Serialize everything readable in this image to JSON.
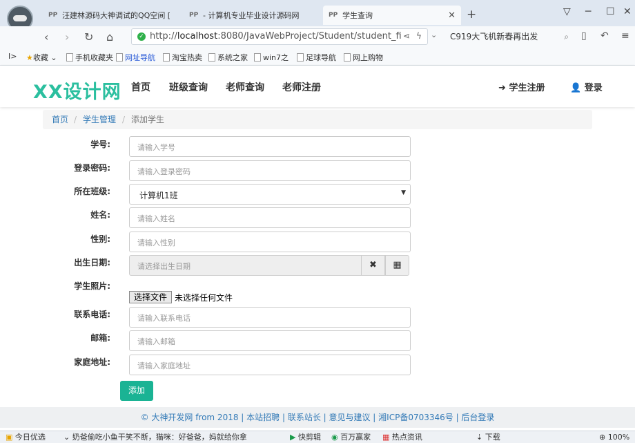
{
  "browser": {
    "tabs": [
      {
        "favicon": "PP",
        "title": "汪建林源码大神调试的QQ空间 [",
        "active": false
      },
      {
        "favicon": "PP",
        "title": "- 计算机专业毕业设计源码网",
        "active": false
      },
      {
        "favicon": "PP",
        "title": "学生查询",
        "active": true
      }
    ],
    "url": {
      "prefix": "http://",
      "host": "localhost",
      "rest": ":8080/JavaWebProject/Student/student_fi"
    },
    "search_text": "C919大飞机新春再出发",
    "bookmarks": [
      {
        "label": "收藏",
        "kind": "star"
      },
      {
        "label": "手机收藏夹",
        "kind": "page"
      },
      {
        "label": "网址导航",
        "kind": "blue"
      },
      {
        "label": "淘宝热卖",
        "kind": "page"
      },
      {
        "label": "系统之家",
        "kind": "page"
      },
      {
        "label": "win7之",
        "kind": "page"
      },
      {
        "label": "足球导航",
        "kind": "page"
      },
      {
        "label": "网上购物",
        "kind": "page"
      }
    ]
  },
  "site": {
    "logo": "XX设计网",
    "nav": [
      "首页",
      "班级查询",
      "老师查询",
      "老师注册"
    ],
    "register_label": "学生注册",
    "login_label": "登录"
  },
  "breadcrumb": {
    "home": "首页",
    "section": "学生管理",
    "current": "添加学生"
  },
  "form": {
    "student_no": {
      "label": "学号:",
      "placeholder": "请输入学号"
    },
    "password": {
      "label": "登录密码:",
      "placeholder": "请输入登录密码"
    },
    "class": {
      "label": "所在班级:",
      "value": "计算机1班"
    },
    "name": {
      "label": "姓名:",
      "placeholder": "请输入姓名"
    },
    "gender": {
      "label": "性别:",
      "placeholder": "请输入性别"
    },
    "birthday": {
      "label": "出生日期:",
      "placeholder": "请选择出生日期"
    },
    "photo": {
      "label": "学生照片:",
      "button": "选择文件",
      "status": "未选择任何文件"
    },
    "phone": {
      "label": "联系电话:",
      "placeholder": "请输入联系电话"
    },
    "email": {
      "label": "邮箱:",
      "placeholder": "请输入邮箱"
    },
    "address": {
      "label": "家庭地址:",
      "placeholder": "请输入家庭地址"
    },
    "submit_label": "添加"
  },
  "footer": {
    "text": "© 大神开发网 from 2018 | 本站招聘 | 联系站长 | 意见与建议 | 湘ICP备0703346号 | 后台登录"
  },
  "statusbar": {
    "left": "今日优选",
    "news": "奶爸偷吃小鱼干笑不断，猫咪：好爸爸，妈就给你拿",
    "items": [
      "快剪辑",
      "百万赢家",
      "热点资讯",
      "下载"
    ],
    "zoom": "100%"
  }
}
